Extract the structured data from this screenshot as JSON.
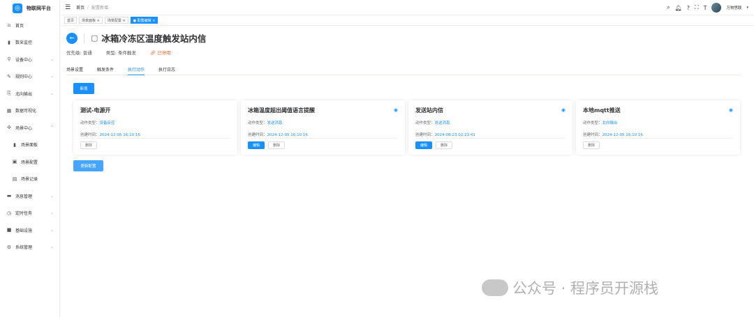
{
  "app": {
    "name": "物联网平台"
  },
  "sidebar": {
    "items": [
      {
        "label": "首页",
        "icon": "home-icon",
        "ch": false
      },
      {
        "label": "数采监控",
        "icon": "chart-icon",
        "ch": false
      },
      {
        "label": "设备中心",
        "icon": "device-icon",
        "ch": true
      },
      {
        "label": "规则中心",
        "icon": "rule-icon",
        "ch": true
      },
      {
        "label": "北向输出",
        "icon": "output-icon",
        "ch": true
      },
      {
        "label": "数据可视化",
        "icon": "visual-icon",
        "ch": false
      },
      {
        "label": "场景中心",
        "icon": "scene-icon",
        "ch": true
      },
      {
        "label": "场景面板",
        "icon": "bar-icon",
        "sub": true
      },
      {
        "label": "场景配置",
        "icon": "config-icon",
        "sub": true
      },
      {
        "label": "场景记录",
        "icon": "record-icon",
        "sub": true
      },
      {
        "label": "消息管理",
        "icon": "message-icon",
        "ch": true
      },
      {
        "label": "定时任务",
        "icon": "clock-icon",
        "ch": true
      },
      {
        "label": "基础设施",
        "icon": "infra-icon",
        "ch": true
      },
      {
        "label": "系统管理",
        "icon": "gear-icon",
        "ch": true
      }
    ]
  },
  "header": {
    "breadcrumb": [
      "首页",
      "配置新增"
    ],
    "user": "万物思联"
  },
  "tags": [
    {
      "label": "首页"
    },
    {
      "label": "场景面板"
    },
    {
      "label": "场景配置"
    },
    {
      "label": "配置编辑",
      "active": true
    }
  ],
  "page": {
    "title": "冰箱冷冻区温度触发站内信",
    "priority": "优先级: 普通",
    "type": "类型: 条件触发",
    "status": "已停用"
  },
  "tabs": [
    "场景设置",
    "触发条件",
    "执行动作",
    "执行日志"
  ],
  "add_label": "新增",
  "save_label": "更新配置",
  "labels": {
    "action_type": "动作类型：",
    "created": "创建时间：",
    "edit": "编辑",
    "delete": "删除"
  },
  "cards": [
    {
      "title": "测试-电源开",
      "type": "设备反控",
      "time": "2024-12-05 16:10:16",
      "eye": false,
      "edit": false
    },
    {
      "title": "冰箱温度超出阈值语言提醒",
      "type": "发送消息",
      "time": "2024-12-05 16:10:16",
      "eye": true,
      "edit": true
    },
    {
      "title": "发送站内信",
      "type": "发送消息",
      "time": "2024-08-23 02:23:41",
      "eye": true,
      "edit": true
    },
    {
      "title": "本地mqtt推送",
      "type": "北向输出",
      "time": "2024-12-05 16:10:16",
      "eye": true,
      "edit": false
    }
  ],
  "watermark": "公众号 · 程序员开源栈"
}
